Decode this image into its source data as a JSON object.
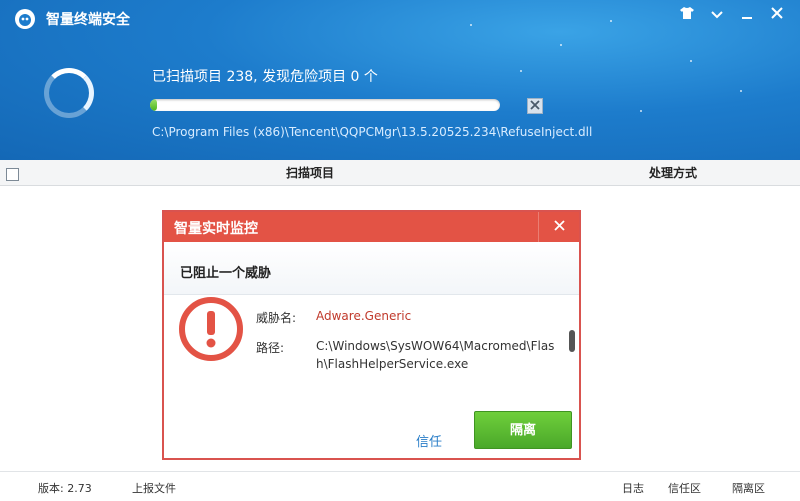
{
  "window": {
    "title": "智量终端安全",
    "skin_icon": "tshirt-icon",
    "menu_icon": "menu-icon",
    "minimize_icon": "minimize-icon",
    "close_icon": "close-icon"
  },
  "scan": {
    "status": "已扫描项目 238, 发现危险项目 0 个",
    "progress_percent": 2,
    "current_path": "C:\\Program Files (x86)\\Tencent\\QQPCMgr\\13.5.20525.234\\RefuseInject.dll",
    "stop_icon": "stop-icon"
  },
  "table": {
    "columns": [
      "扫描项目",
      "处理方式"
    ]
  },
  "dialog": {
    "title": "智量实时监控",
    "heading": "已阻止一个威胁",
    "threat_label": "威胁名:",
    "threat_name": "Adware.Generic",
    "path_label": "路径:",
    "path_value": "C:\\Windows\\SysWOW64\\Macromed\\Flash\\FlashHelperService.exe",
    "trust_label": "信任",
    "isolate_label": "隔离",
    "warning_icon": "warning-icon",
    "accent_color": "#e35345"
  },
  "footer": {
    "version": "版本: 2.73",
    "upload": "上报文件",
    "log": "日志",
    "trust_zone": "信任区",
    "quarantine_zone": "隔离区"
  }
}
